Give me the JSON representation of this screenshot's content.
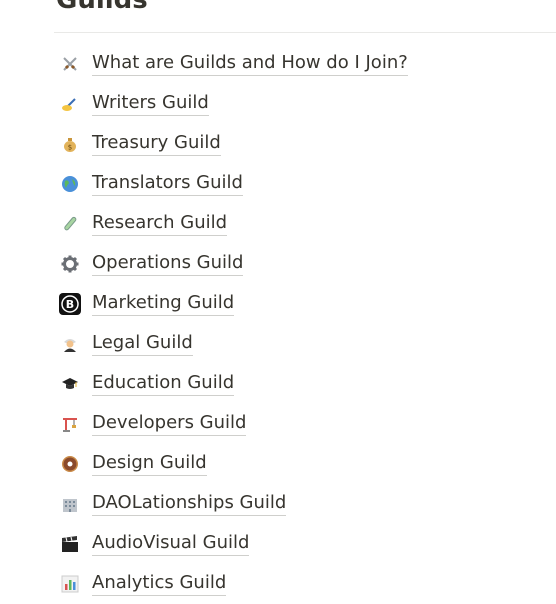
{
  "page": {
    "title": "Guilds"
  },
  "guilds": [
    {
      "label": "What are Guilds and How do I Join?",
      "icon": "crossed-swords-icon",
      "glyph": "⚔"
    },
    {
      "label": "Writers Guild",
      "icon": "writing-hand-icon",
      "glyph": "✍"
    },
    {
      "label": "Treasury Guild",
      "icon": "money-bag-icon",
      "glyph": ""
    },
    {
      "label": "Translators Guild",
      "icon": "globe-icon",
      "glyph": ""
    },
    {
      "label": "Research Guild",
      "icon": "test-tube-icon",
      "glyph": ""
    },
    {
      "label": "Operations Guild",
      "icon": "gear-icon",
      "glyph": "⚙"
    },
    {
      "label": "Marketing Guild",
      "icon": "bitcoin-icon",
      "glyph": ""
    },
    {
      "label": "Legal Guild",
      "icon": "judge-icon",
      "glyph": ""
    },
    {
      "label": "Education Guild",
      "icon": "graduation-cap-icon",
      "glyph": ""
    },
    {
      "label": "Developers Guild",
      "icon": "crane-icon",
      "glyph": ""
    },
    {
      "label": "Design Guild",
      "icon": "donut-icon",
      "glyph": ""
    },
    {
      "label": "DAOLationships Guild",
      "icon": "office-building-icon",
      "glyph": ""
    },
    {
      "label": "AudioVisual Guild",
      "icon": "clapper-board-icon",
      "glyph": ""
    },
    {
      "label": "Analytics Guild",
      "icon": "bar-chart-icon",
      "glyph": ""
    }
  ],
  "colors": {
    "text": "#37352f",
    "underline": "#cfcfcc",
    "divider": "#e9e9e7"
  }
}
